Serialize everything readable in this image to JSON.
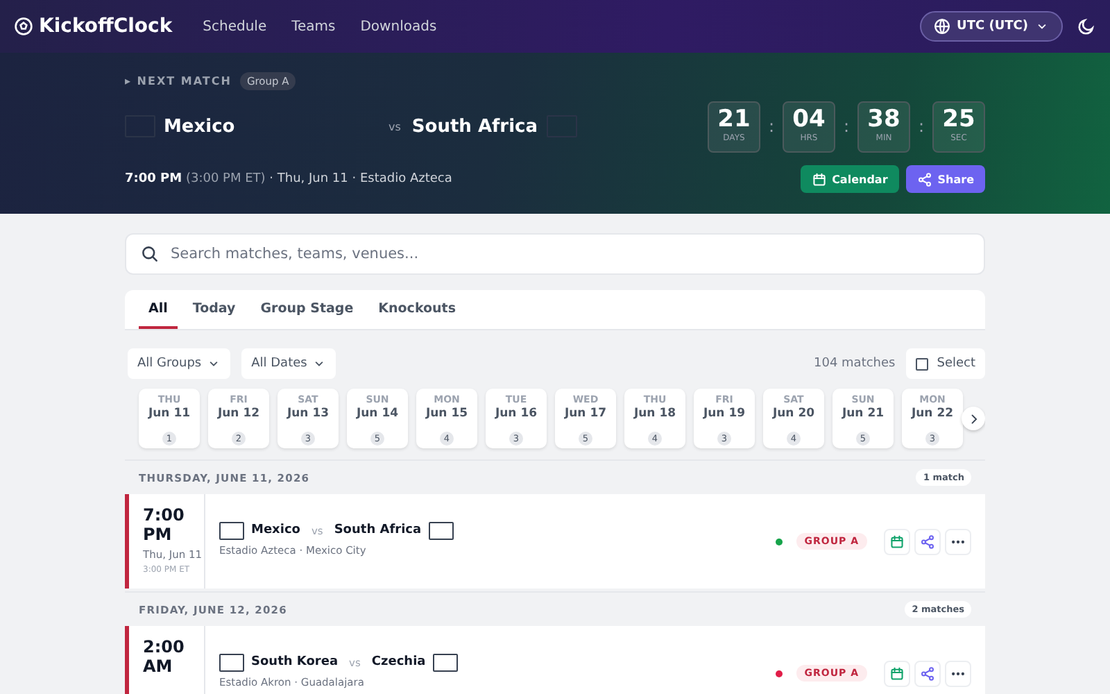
{
  "header": {
    "brand": "KickoffClock",
    "nav": [
      {
        "label": "Schedule"
      },
      {
        "label": "Teams"
      },
      {
        "label": "Downloads"
      }
    ],
    "timezone": "UTC (UTC)"
  },
  "next_match": {
    "eyebrow": "▸ NEXT MATCH",
    "group": "Group A",
    "home": "Mexico",
    "vs": "vs",
    "away": "South Africa",
    "separator": ":",
    "countdown": [
      {
        "value": "21",
        "unit": "DAYS"
      },
      {
        "value": "04",
        "unit": "HRS"
      },
      {
        "value": "38",
        "unit": "MIN"
      },
      {
        "value": "25",
        "unit": "SEC"
      }
    ],
    "time": "7:00 PM",
    "local_time": "(3:00 PM ET)",
    "details": "· Thu, Jun 11 · Estadio Azteca",
    "buttons": [
      {
        "label": "Calendar",
        "kind": "calendar"
      },
      {
        "label": "Share",
        "kind": "share"
      }
    ]
  },
  "search": {
    "placeholder": "Search matches, teams, venues..."
  },
  "tabs": [
    {
      "label": "All",
      "selected": true
    },
    {
      "label": "Today",
      "selected": false
    },
    {
      "label": "Group Stage",
      "selected": false
    },
    {
      "label": "Knockouts",
      "selected": false
    }
  ],
  "filters": [
    "All Groups",
    "All Dates"
  ],
  "match_count": "104 matches",
  "select": {
    "label": "Select",
    "checked": false
  },
  "dates": [
    {
      "weekday": "THU",
      "date": "Jun 11",
      "count": "1"
    },
    {
      "weekday": "FRI",
      "date": "Jun 12",
      "count": "2"
    },
    {
      "weekday": "SAT",
      "date": "Jun 13",
      "count": "3"
    },
    {
      "weekday": "SUN",
      "date": "Jun 14",
      "count": "5"
    },
    {
      "weekday": "MON",
      "date": "Jun 15",
      "count": "4"
    },
    {
      "weekday": "TUE",
      "date": "Jun 16",
      "count": "3"
    },
    {
      "weekday": "WED",
      "date": "Jun 17",
      "count": "5"
    },
    {
      "weekday": "THU",
      "date": "Jun 18",
      "count": "4"
    },
    {
      "weekday": "FRI",
      "date": "Jun 19",
      "count": "3"
    },
    {
      "weekday": "SAT",
      "date": "Jun 20",
      "count": "4"
    },
    {
      "weekday": "SUN",
      "date": "Jun 21",
      "count": "5"
    },
    {
      "weekday": "MON",
      "date": "Jun 22",
      "count": "3"
    }
  ],
  "days": [
    {
      "heading": "THURSDAY, JUNE 11, 2026",
      "count": "1 match",
      "matches": [
        {
          "time": "7:00 PM",
          "date": "Thu, Jun 11",
          "local": "3:00 PM ET",
          "home": "Mexico",
          "vs": "vs",
          "away": "South Africa",
          "venue": "Estadio Azteca · Mexico City",
          "color": "#16a34a",
          "group": "GROUP A"
        }
      ]
    },
    {
      "heading": "FRIDAY, JUNE 12, 2026",
      "count": "2 matches",
      "matches": [
        {
          "time": "2:00 AM",
          "home": "South Korea",
          "vs": "vs",
          "away": "Czechia",
          "venue": "Estadio Akron · Guadalajara",
          "color": "#e11d48",
          "group": "GROUP A"
        }
      ]
    }
  ]
}
